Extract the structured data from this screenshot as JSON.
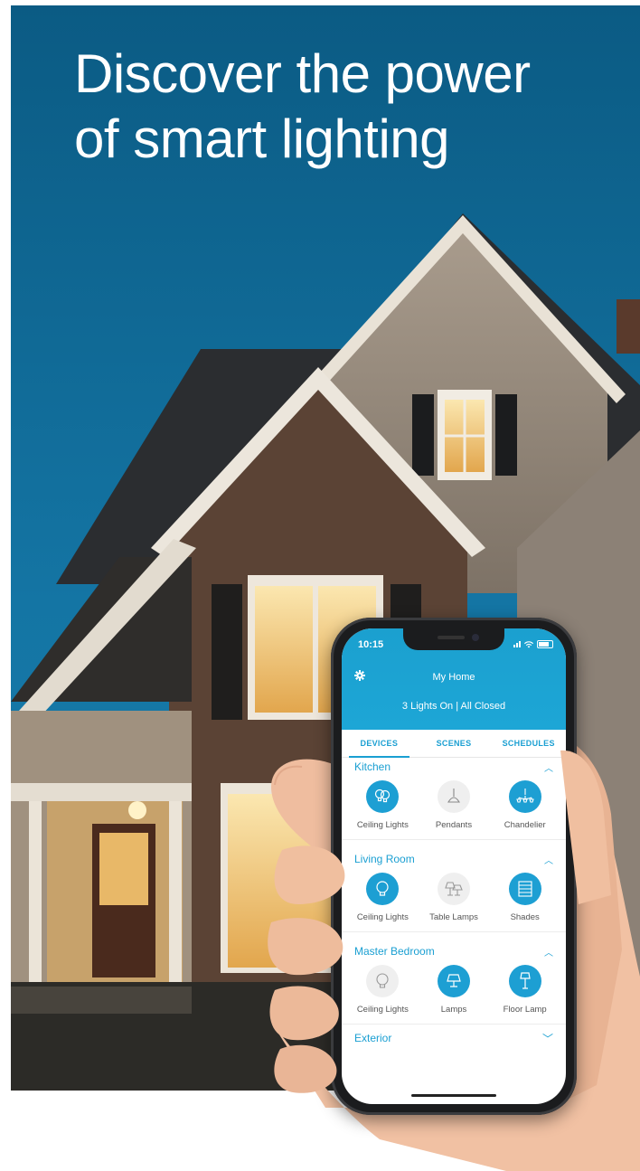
{
  "headline": {
    "line1": "Discover the power",
    "line2": "of smart lighting"
  },
  "phone": {
    "status_bar": {
      "time": "10:15"
    },
    "header": {
      "title": "My Home",
      "status": "3 Lights On | All Closed",
      "settings_icon": "gear-icon"
    },
    "tabs": [
      {
        "label": "DEVICES",
        "active": true
      },
      {
        "label": "SCENES",
        "active": false
      },
      {
        "label": "SCHEDULES",
        "active": false
      }
    ],
    "rooms": [
      {
        "name": "Kitchen",
        "expanded": true,
        "devices": [
          {
            "label": "Ceiling Lights",
            "icon": "bulbs-icon",
            "on": true
          },
          {
            "label": "Pendants",
            "icon": "pendant-icon",
            "on": false
          },
          {
            "label": "Chandelier",
            "icon": "chandelier-icon",
            "on": true
          }
        ]
      },
      {
        "name": "Living Room",
        "expanded": true,
        "devices": [
          {
            "label": "Ceiling Lights",
            "icon": "bulb-icon",
            "on": true
          },
          {
            "label": "Table Lamps",
            "icon": "table-lamps-icon",
            "on": false
          },
          {
            "label": "Shades",
            "icon": "shades-icon",
            "on": true
          }
        ]
      },
      {
        "name": "Master Bedroom",
        "expanded": true,
        "devices": [
          {
            "label": "Ceiling Lights",
            "icon": "bulb-icon",
            "on": false
          },
          {
            "label": "Lamps",
            "icon": "lamp-icon",
            "on": true
          },
          {
            "label": "Floor Lamp",
            "icon": "floor-lamp-icon",
            "on": true
          }
        ]
      },
      {
        "name": "Exterior",
        "expanded": false,
        "devices": []
      }
    ],
    "colors": {
      "accent": "#1d9fd3",
      "sky": "#0d5f86"
    }
  }
}
